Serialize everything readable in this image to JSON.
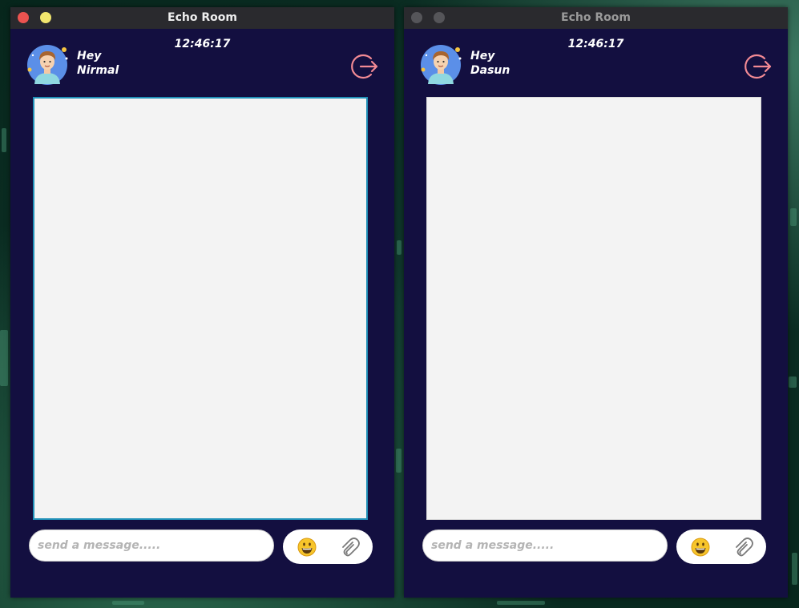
{
  "windows": [
    {
      "title": "Echo Room",
      "greeting": {
        "line1": "Hey",
        "line2": "Nirmal"
      },
      "time": "12:46:17",
      "input_placeholder": "send a message.....",
      "input_value": "",
      "active": true
    },
    {
      "title": "Echo Room",
      "greeting": {
        "line1": "Hey",
        "line2": "Dasun"
      },
      "time": "12:46:17",
      "input_placeholder": "send a message.....",
      "input_value": "",
      "active": false
    }
  ],
  "icons": {
    "avatar": "user-avatar-icon",
    "logout": "logout-icon",
    "emoji": "grinning-face-icon",
    "attach": "paperclip-icon"
  },
  "colors": {
    "window_bg": "#130f40",
    "chat_bg": "#f3f3f3",
    "logout_accent": "#f28a94",
    "focus_border": "#2090b8",
    "close_button": "#ec5350",
    "minimize_button": "#f1e66e"
  }
}
